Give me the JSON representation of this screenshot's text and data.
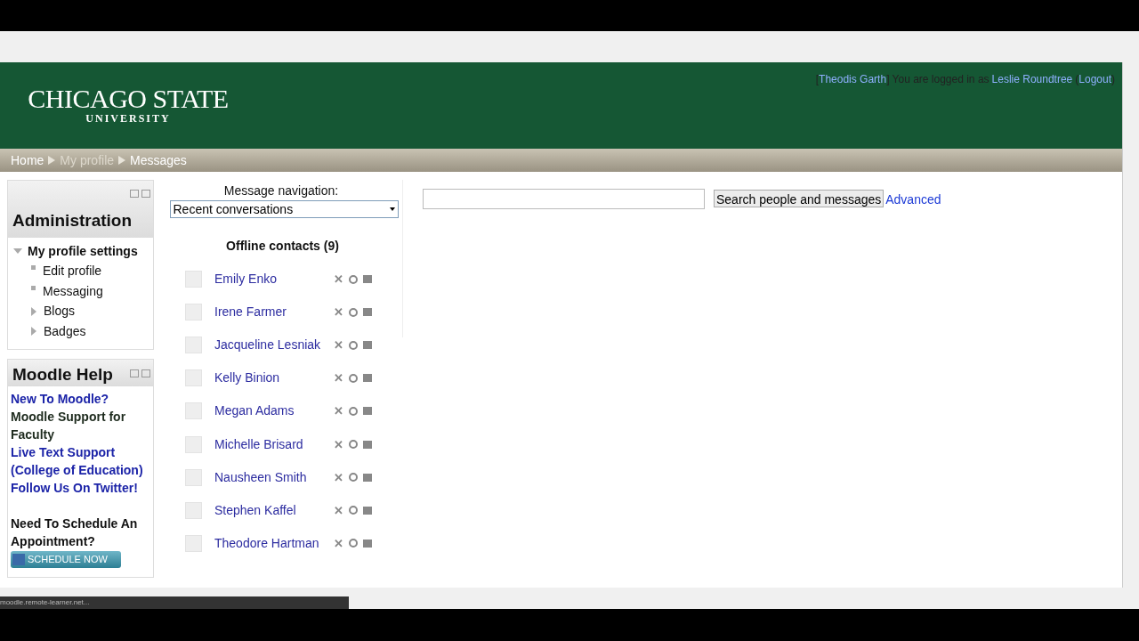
{
  "header": {
    "logo_title": "CHICAGO STATE",
    "logo_subtitle": "UNIVERSITY",
    "login": {
      "open_bracket": "[",
      "role_user": "Theodis Garth",
      "text": "] You are logged in as",
      "user": "Leslie Roundtree",
      "open_paren": "(",
      "logout": "Logout",
      "close_paren": ")"
    }
  },
  "breadcrumb": [
    {
      "label": "Home",
      "dim": false
    },
    {
      "label": "My profile",
      "dim": true
    },
    {
      "label": "Messages",
      "dim": false
    }
  ],
  "contact_action_glyph": "✕",
  "administration": {
    "title": "Administration",
    "items": [
      {
        "label": "My profile settings",
        "kind": "expanded",
        "children": [
          {
            "label": "Edit profile",
            "kind": "leaf"
          },
          {
            "label": "Messaging",
            "kind": "leaf"
          },
          {
            "label": "Blogs",
            "kind": "collapsed"
          },
          {
            "label": "Badges",
            "kind": "collapsed"
          }
        ]
      }
    ]
  },
  "moodle_help": {
    "title": "Moodle Help",
    "lines": [
      {
        "text": "New To Moodle?",
        "kind": "link"
      },
      {
        "text": "Moodle Support for Faculty",
        "kind": "text"
      },
      {
        "text": "Live Text Support (College of Education)",
        "kind": "link"
      },
      {
        "text": "Follow Us On Twitter!",
        "kind": "link"
      },
      {
        "text": "Need To Schedule An Appointment?",
        "kind": "heading"
      }
    ],
    "button": "SCHEDULE NOW"
  },
  "message_navigation": {
    "label": "Message navigation:",
    "value": "Recent conversations"
  },
  "contacts": {
    "title": "Offline contacts (9)",
    "items": [
      {
        "name": "Emily Enko"
      },
      {
        "name": "Irene Farmer"
      },
      {
        "name": "Jacqueline Lesniak"
      },
      {
        "name": "Kelly Binion"
      },
      {
        "name": "Megan Adams"
      },
      {
        "name": "Michelle Brisard"
      },
      {
        "name": "Nausheen Smith"
      },
      {
        "name": "Stephen Kaffel"
      },
      {
        "name": "Theodore Hartman"
      }
    ]
  },
  "search": {
    "button": "Search people and messages",
    "advanced": "Advanced"
  },
  "status_url": "moodle.remote-learner.net..."
}
